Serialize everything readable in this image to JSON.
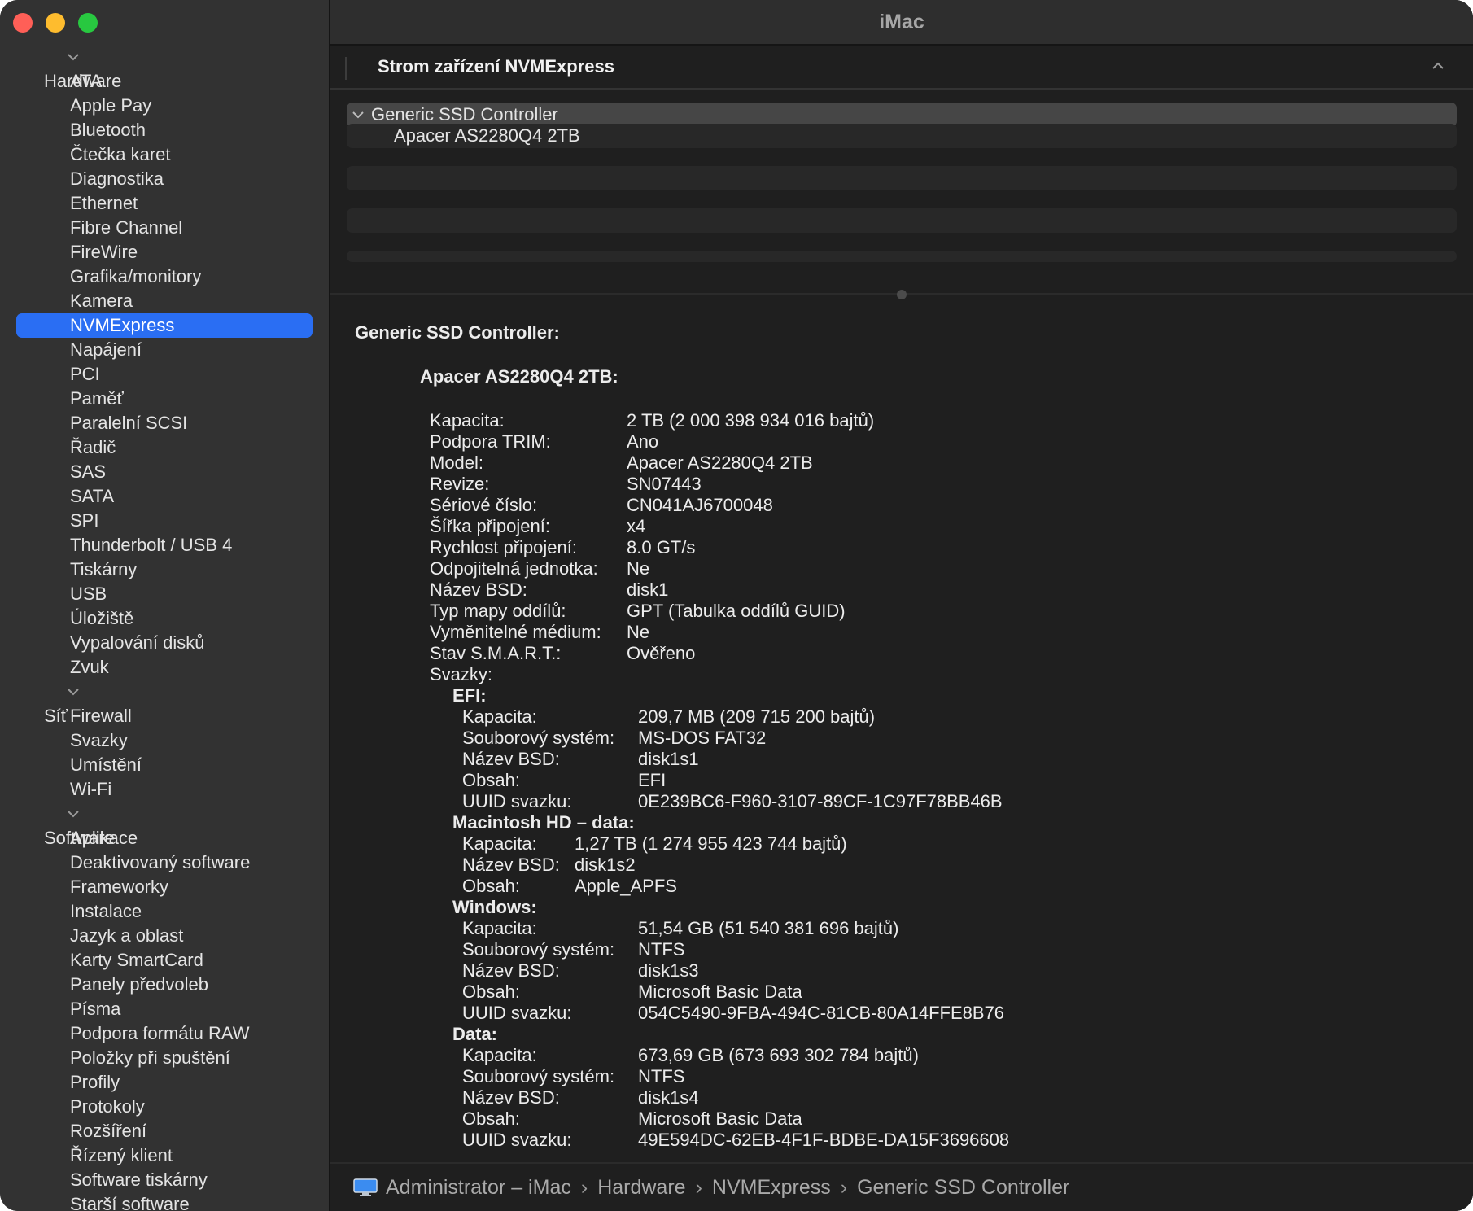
{
  "window": {
    "title": "iMac"
  },
  "sidebar": {
    "groups": [
      {
        "label": "Hardware",
        "items": [
          "ATA",
          "Apple Pay",
          "Bluetooth",
          "Čtečka karet",
          "Diagnostika",
          "Ethernet",
          "Fibre Channel",
          "FireWire",
          "Grafika/monitory",
          "Kamera",
          "NVMExpress",
          "Napájení",
          "PCI",
          "Paměť",
          "Paralelní SCSI",
          "Řadič",
          "SAS",
          "SATA",
          "SPI",
          "Thunderbolt / USB 4",
          "Tiskárny",
          "USB",
          "Úložiště",
          "Vypalování disků",
          "Zvuk"
        ]
      },
      {
        "label": "Síť",
        "items": [
          "Firewall",
          "Svazky",
          "Umístění",
          "Wi-Fi"
        ]
      },
      {
        "label": "Software",
        "items": [
          "Aplikace",
          "Deaktivovaný software",
          "Frameworky",
          "Instalace",
          "Jazyk a oblast",
          "Karty SmartCard",
          "Panely předvoleb",
          "Písma",
          "Podpora formátu RAW",
          "Položky při spuštění",
          "Profily",
          "Protokoly",
          "Rozšíření",
          "Řízený klient",
          "Software tiskárny",
          "Starší software"
        ]
      }
    ],
    "selected": "NVMExpress"
  },
  "tree": {
    "header": "Strom zařízení NVMExpress",
    "controller": "Generic SSD Controller",
    "device": "Apacer AS2280Q4 2TB"
  },
  "details": {
    "controller_heading": "Generic SSD Controller:",
    "device_heading": "Apacer AS2280Q4 2TB:",
    "fields": [
      {
        "k": "Kapacita:",
        "v": "2 TB (2 000 398 934 016 bajtů)"
      },
      {
        "k": "Podpora TRIM:",
        "v": "Ano"
      },
      {
        "k": "Model:",
        "v": "Apacer AS2280Q4 2TB"
      },
      {
        "k": "Revize:",
        "v": "SN07443"
      },
      {
        "k": "Sériové číslo:",
        "v": "CN041AJ6700048"
      },
      {
        "k": "Šířka připojení:",
        "v": "x4"
      },
      {
        "k": "Rychlost připojení:",
        "v": "8.0 GT/s"
      },
      {
        "k": "Odpojitelná jednotka:",
        "v": "Ne"
      },
      {
        "k": "Název BSD:",
        "v": "disk1"
      },
      {
        "k": "Typ mapy oddílů:",
        "v": "GPT (Tabulka oddílů GUID)"
      },
      {
        "k": "Vyměnitelné médium:",
        "v": "Ne"
      },
      {
        "k": "Stav S.M.A.R.T.:",
        "v": "Ověřeno"
      }
    ],
    "volumes_label": "Svazky:",
    "volumes": [
      {
        "name": "EFI:",
        "fields": [
          {
            "k": "Kapacita:",
            "v": "209,7 MB (209 715 200 bajtů)"
          },
          {
            "k": "Souborový systém:",
            "v": "MS-DOS FAT32"
          },
          {
            "k": "Název BSD:",
            "v": "disk1s1"
          },
          {
            "k": "Obsah:",
            "v": "EFI"
          },
          {
            "k": "UUID svazku:",
            "v": "0E239BC6-F960-3107-89CF-1C97F78BB46B"
          }
        ]
      },
      {
        "name": "Macintosh HD – data:",
        "fields": [
          {
            "k": "Kapacita:",
            "v": "1,27 TB (1 274 955 423 744 bajtů)"
          },
          {
            "k": "Název BSD:",
            "v": "disk1s2"
          },
          {
            "k": "Obsah:",
            "v": "Apple_APFS"
          }
        ]
      },
      {
        "name": "Windows:",
        "fields": [
          {
            "k": "Kapacita:",
            "v": "51,54 GB (51 540 381 696 bajtů)"
          },
          {
            "k": "Souborový systém:",
            "v": "NTFS"
          },
          {
            "k": "Název BSD:",
            "v": "disk1s3"
          },
          {
            "k": "Obsah:",
            "v": "Microsoft Basic Data"
          },
          {
            "k": "UUID svazku:",
            "v": "054C5490-9FBA-494C-81CB-80A14FFE8B76"
          }
        ]
      },
      {
        "name": "Data:",
        "fields": [
          {
            "k": "Kapacita:",
            "v": "673,69 GB (673 693 302 784 bajtů)"
          },
          {
            "k": "Souborový systém:",
            "v": "NTFS"
          },
          {
            "k": "Název BSD:",
            "v": "disk1s4"
          },
          {
            "k": "Obsah:",
            "v": "Microsoft Basic Data"
          },
          {
            "k": "UUID svazku:",
            "v": "49E594DC-62EB-4F1F-BDBE-DA15F3696608"
          }
        ]
      }
    ]
  },
  "statusbar": {
    "path": [
      "Administrator – iMac",
      "Hardware",
      "NVMExpress",
      "Generic SSD Controller"
    ],
    "separator": "›"
  },
  "icons": {
    "computer": "imac-icon",
    "disclosure": "chevron-down-icon",
    "collapse": "chevron-up-icon"
  },
  "colors": {
    "selection": "#2a6ef3",
    "sidebar": "#323232",
    "content": "#1f1f1f"
  }
}
